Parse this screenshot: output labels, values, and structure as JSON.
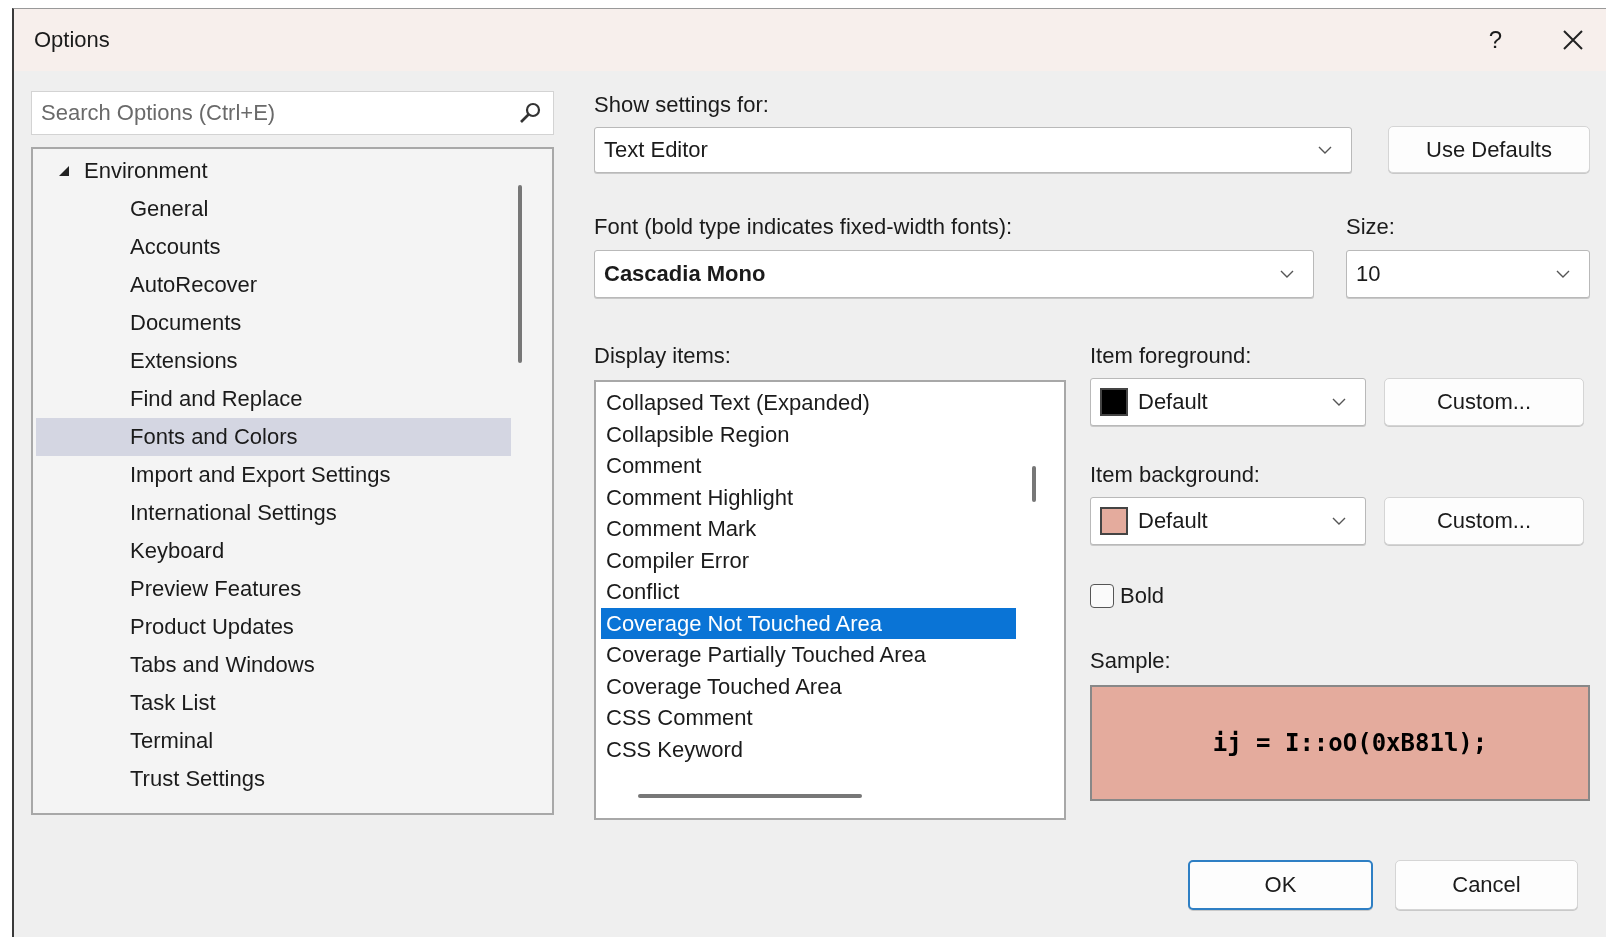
{
  "window": {
    "title": "Options",
    "help": "?"
  },
  "search": {
    "placeholder": "Search Options (Ctrl+E)"
  },
  "tree": [
    {
      "label": "Environment",
      "expanded": true,
      "selected": false,
      "children": [
        {
          "label": "General",
          "selected": false
        },
        {
          "label": "Accounts",
          "selected": false
        },
        {
          "label": "AutoRecover",
          "selected": false
        },
        {
          "label": "Documents",
          "selected": false
        },
        {
          "label": "Extensions",
          "selected": false
        },
        {
          "label": "Find and Replace",
          "selected": false
        },
        {
          "label": "Fonts and Colors",
          "selected": true
        },
        {
          "label": "Import and Export Settings",
          "selected": false
        },
        {
          "label": "International Settings",
          "selected": false
        },
        {
          "label": "Keyboard",
          "selected": false
        },
        {
          "label": "Preview Features",
          "selected": false
        },
        {
          "label": "Product Updates",
          "selected": false
        },
        {
          "label": "Tabs and Windows",
          "selected": false
        },
        {
          "label": "Task List",
          "selected": false
        },
        {
          "label": "Terminal",
          "selected": false
        },
        {
          "label": "Trust Settings",
          "selected": false
        }
      ]
    }
  ],
  "show_settings": {
    "label": "Show settings for:",
    "value": "Text Editor"
  },
  "use_defaults": "Use Defaults",
  "font": {
    "label": "Font (bold type indicates fixed-width fonts):",
    "value": "Cascadia Mono"
  },
  "size": {
    "label": "Size:",
    "value": "10"
  },
  "display_items": {
    "label": "Display items:",
    "items": [
      {
        "label": "Collapsed Text (Expanded)",
        "selected": false
      },
      {
        "label": "Collapsible Region",
        "selected": false
      },
      {
        "label": "Comment",
        "selected": false
      },
      {
        "label": "Comment Highlight",
        "selected": false
      },
      {
        "label": "Comment Mark",
        "selected": false
      },
      {
        "label": "Compiler Error",
        "selected": false
      },
      {
        "label": "Conflict",
        "selected": false
      },
      {
        "label": "Coverage Not Touched Area",
        "selected": true
      },
      {
        "label": "Coverage Partially Touched Area",
        "selected": false
      },
      {
        "label": "Coverage Touched Area",
        "selected": false
      },
      {
        "label": "CSS Comment",
        "selected": false
      },
      {
        "label": "CSS Keyword",
        "selected": false
      }
    ]
  },
  "foreground": {
    "label": "Item foreground:",
    "value": "Default",
    "color": "#000000",
    "button": "Custom..."
  },
  "background": {
    "label": "Item background:",
    "value": "Default",
    "color": "#e4ab9d",
    "button": "Custom..."
  },
  "bold": {
    "label": "Bold",
    "checked": false
  },
  "sample": {
    "label": "Sample:",
    "text": "ij = I::oO(0xB81l);"
  },
  "buttons": [
    {
      "label": "OK",
      "default": true
    },
    {
      "label": "Cancel",
      "default": false
    }
  ]
}
